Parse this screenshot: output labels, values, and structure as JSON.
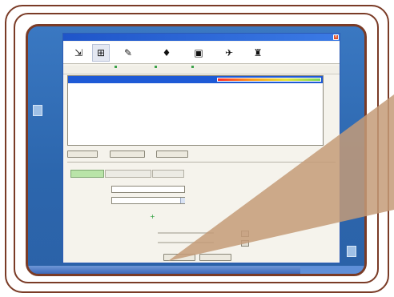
{
  "window": {
    "title": "",
    "close_glyph": "×"
  },
  "toolbar": {
    "tools": [
      {
        "icon": "tool-icon-1",
        "glyph": "⇲"
      },
      {
        "icon": "tool-icon-2",
        "glyph": "⊞"
      },
      {
        "icon": "tool-icon-3",
        "glyph": "✎"
      },
      {
        "icon": "tool-icon-4",
        "glyph": "♦"
      },
      {
        "icon": "tool-icon-5",
        "glyph": "▣"
      },
      {
        "icon": "tool-icon-6",
        "glyph": "✈"
      },
      {
        "icon": "tool-icon-7",
        "glyph": "♜"
      }
    ]
  },
  "list": {
    "selected_row_label": ""
  },
  "buttons": {
    "btn1": "",
    "btn2": "",
    "btn3": "",
    "ok": "",
    "cancel": ""
  },
  "tabs": [
    {
      "label": ""
    },
    {
      "label": ""
    },
    {
      "label": ""
    }
  ],
  "form": {
    "field1_value": "",
    "field2_value": ""
  },
  "colors": {
    "frame": "#7a3b26",
    "titlebar": "#1f55c9",
    "selection": "#1e5ad6",
    "wedge": "rgba(196,155,120,0.85)"
  }
}
